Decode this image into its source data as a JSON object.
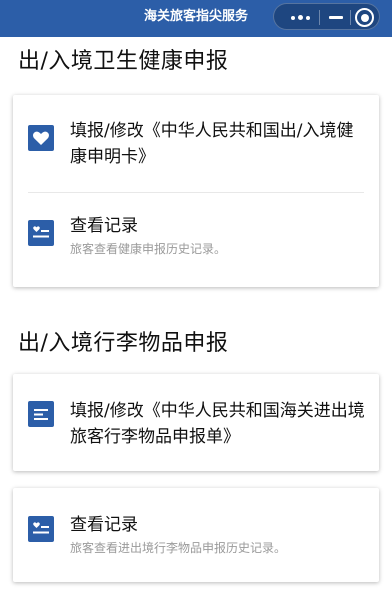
{
  "app": {
    "title": "海关旅客指尖服务"
  },
  "sections": [
    {
      "title": "出/入境卫生健康申报",
      "items": [
        {
          "label": "填报/修改《中华人民共和国出/入境健康申明卡》",
          "icon": "heart-icon"
        },
        {
          "label": "查看记录",
          "subtitle": "旅客查看健康申报历史记录。",
          "icon": "record-list-icon"
        }
      ]
    },
    {
      "title": "出/入境行李物品申报",
      "items": [
        {
          "label": "填报/修改《中华人民共和国海关进出境旅客行李物品申报单》",
          "icon": "form-lines-icon"
        },
        {
          "label": "查看记录",
          "subtitle": "旅客查看进出境行李物品申报历史记录。",
          "icon": "record-list-icon"
        }
      ]
    }
  ],
  "colors": {
    "header": "#2c5ea8",
    "icon_bg": "#2c5ea8",
    "subtitle": "#9a9a9a"
  }
}
